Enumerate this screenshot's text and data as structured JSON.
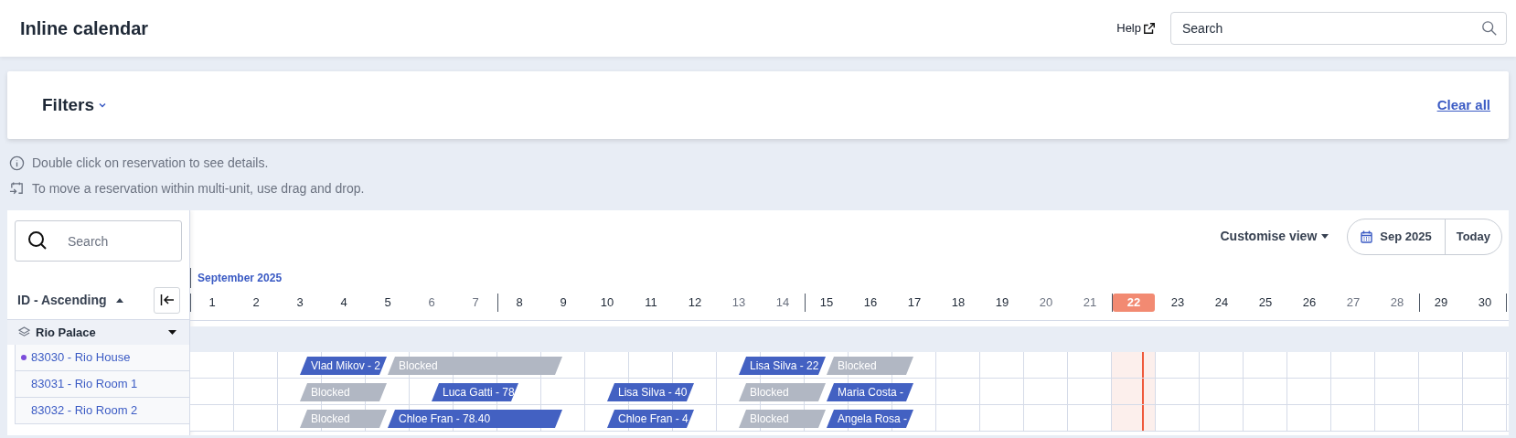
{
  "header": {
    "title": "Inline calendar",
    "help": "Help",
    "search": {
      "placeholder": "Search"
    }
  },
  "filters": {
    "title": "Filters",
    "expanded": false,
    "clear": "Clear all"
  },
  "hints": [
    {
      "kind": "info",
      "text": "Double click on reservation to see details."
    },
    {
      "kind": "move",
      "text": "To move a reservation within multi-unit, use drag and drop."
    }
  ],
  "calendar": {
    "search": {
      "placeholder": "Search"
    },
    "sort": "ID - Ascending",
    "customise": "Customise view",
    "month_picker": "Sep 2025",
    "today_button": "Today",
    "month": "September 2025",
    "days": [
      {
        "label": "1",
        "weekend": false,
        "week_start": true,
        "today": false
      },
      {
        "label": "2",
        "weekend": false,
        "week_start": false,
        "today": false
      },
      {
        "label": "3",
        "weekend": false,
        "week_start": false,
        "today": false
      },
      {
        "label": "4",
        "weekend": false,
        "week_start": false,
        "today": false
      },
      {
        "label": "5",
        "weekend": false,
        "week_start": false,
        "today": false
      },
      {
        "label": "6",
        "weekend": true,
        "week_start": false,
        "today": false
      },
      {
        "label": "7",
        "weekend": true,
        "week_start": false,
        "today": false
      },
      {
        "label": "8",
        "weekend": false,
        "week_start": true,
        "today": false
      },
      {
        "label": "9",
        "weekend": false,
        "week_start": false,
        "today": false
      },
      {
        "label": "10",
        "weekend": false,
        "week_start": false,
        "today": false
      },
      {
        "label": "11",
        "weekend": false,
        "week_start": false,
        "today": false
      },
      {
        "label": "12",
        "weekend": false,
        "week_start": false,
        "today": false
      },
      {
        "label": "13",
        "weekend": true,
        "week_start": false,
        "today": false
      },
      {
        "label": "14",
        "weekend": true,
        "week_start": false,
        "today": false
      },
      {
        "label": "15",
        "weekend": false,
        "week_start": true,
        "today": false
      },
      {
        "label": "16",
        "weekend": false,
        "week_start": false,
        "today": false
      },
      {
        "label": "17",
        "weekend": false,
        "week_start": false,
        "today": false
      },
      {
        "label": "18",
        "weekend": false,
        "week_start": false,
        "today": false
      },
      {
        "label": "19",
        "weekend": false,
        "week_start": false,
        "today": false
      },
      {
        "label": "20",
        "weekend": true,
        "week_start": false,
        "today": false
      },
      {
        "label": "21",
        "weekend": true,
        "week_start": false,
        "today": false
      },
      {
        "label": "22",
        "weekend": false,
        "week_start": true,
        "today": true
      },
      {
        "label": "23",
        "weekend": false,
        "week_start": false,
        "today": false
      },
      {
        "label": "24",
        "weekend": false,
        "week_start": false,
        "today": false
      },
      {
        "label": "25",
        "weekend": false,
        "week_start": false,
        "today": false
      },
      {
        "label": "26",
        "weekend": false,
        "week_start": false,
        "today": false
      },
      {
        "label": "27",
        "weekend": true,
        "week_start": false,
        "today": false
      },
      {
        "label": "28",
        "weekend": true,
        "week_start": false,
        "today": false
      },
      {
        "label": "29",
        "weekend": false,
        "week_start": true,
        "today": false
      },
      {
        "label": "30",
        "weekend": false,
        "week_start": false,
        "today": false
      }
    ],
    "groups": [
      {
        "name": "Rio Palace",
        "expanded": true,
        "units": [
          {
            "name": "83030 - Rio House",
            "flagged": true,
            "cells": [
              {
                "kind": "empty"
              },
              {
                "kind": "empty"
              },
              {
                "kind": "reservation",
                "text": "Vlad Mikov - 2"
              },
              {
                "kind": "continued"
              },
              {
                "kind": "blocked",
                "text": "Blocked"
              },
              {
                "kind": "continued"
              },
              {
                "kind": "continued"
              },
              {
                "kind": "continued"
              },
              {
                "kind": "empty"
              },
              {
                "kind": "empty"
              },
              {
                "kind": "empty"
              },
              {
                "kind": "empty"
              },
              {
                "kind": "reservation",
                "text": "Lisa Silva - 22"
              },
              {
                "kind": "continued"
              },
              {
                "kind": "blocked",
                "text": "Blocked"
              },
              {
                "kind": "continued"
              },
              {
                "kind": "empty"
              },
              {
                "kind": "empty"
              },
              {
                "kind": "empty"
              },
              {
                "kind": "empty"
              },
              {
                "kind": "empty"
              },
              {
                "kind": "empty"
              },
              {
                "kind": "empty"
              },
              {
                "kind": "empty"
              },
              {
                "kind": "empty"
              },
              {
                "kind": "empty"
              },
              {
                "kind": "empty"
              },
              {
                "kind": "empty"
              },
              {
                "kind": "empty"
              },
              {
                "kind": "empty"
              }
            ]
          },
          {
            "name": "83031 - Rio Room 1",
            "flagged": false,
            "cells": [
              {
                "kind": "empty"
              },
              {
                "kind": "empty"
              },
              {
                "kind": "blocked",
                "text": "Blocked"
              },
              {
                "kind": "continued"
              },
              {
                "kind": "empty"
              },
              {
                "kind": "reservation",
                "text": "Luca Gatti - 78"
              },
              {
                "kind": "continued"
              },
              {
                "kind": "empty"
              },
              {
                "kind": "empty"
              },
              {
                "kind": "reservation",
                "text": "Lisa Silva - 40"
              },
              {
                "kind": "continued"
              },
              {
                "kind": "empty"
              },
              {
                "kind": "blocked",
                "text": "Blocked"
              },
              {
                "kind": "continued"
              },
              {
                "kind": "reservation",
                "text": "Maria Costa -"
              },
              {
                "kind": "continued"
              },
              {
                "kind": "empty"
              },
              {
                "kind": "empty"
              },
              {
                "kind": "empty"
              },
              {
                "kind": "empty"
              },
              {
                "kind": "empty"
              },
              {
                "kind": "empty"
              },
              {
                "kind": "empty"
              },
              {
                "kind": "empty"
              },
              {
                "kind": "empty"
              },
              {
                "kind": "empty"
              },
              {
                "kind": "empty"
              },
              {
                "kind": "empty"
              },
              {
                "kind": "empty"
              },
              {
                "kind": "empty"
              }
            ]
          },
          {
            "name": "83032 - Rio Room 2",
            "flagged": false,
            "cells": [
              {
                "kind": "empty"
              },
              {
                "kind": "empty"
              },
              {
                "kind": "blocked",
                "text": "Blocked"
              },
              {
                "kind": "continued"
              },
              {
                "kind": "reservation",
                "text": "Chloe Fran - 78.40"
              },
              {
                "kind": "continued"
              },
              {
                "kind": "continued"
              },
              {
                "kind": "continued"
              },
              {
                "kind": "empty"
              },
              {
                "kind": "reservation",
                "text": "Chloe Fran - 4"
              },
              {
                "kind": "continued"
              },
              {
                "kind": "empty"
              },
              {
                "kind": "blocked",
                "text": "Blocked"
              },
              {
                "kind": "continued"
              },
              {
                "kind": "reservation",
                "text": "Angela Rosa -"
              },
              {
                "kind": "continued"
              },
              {
                "kind": "empty"
              },
              {
                "kind": "empty"
              },
              {
                "kind": "empty"
              },
              {
                "kind": "empty"
              },
              {
                "kind": "empty"
              },
              {
                "kind": "empty"
              },
              {
                "kind": "empty"
              },
              {
                "kind": "empty"
              },
              {
                "kind": "empty"
              },
              {
                "kind": "empty"
              },
              {
                "kind": "empty"
              },
              {
                "kind": "empty"
              },
              {
                "kind": "empty"
              },
              {
                "kind": "empty"
              }
            ]
          }
        ]
      }
    ]
  }
}
